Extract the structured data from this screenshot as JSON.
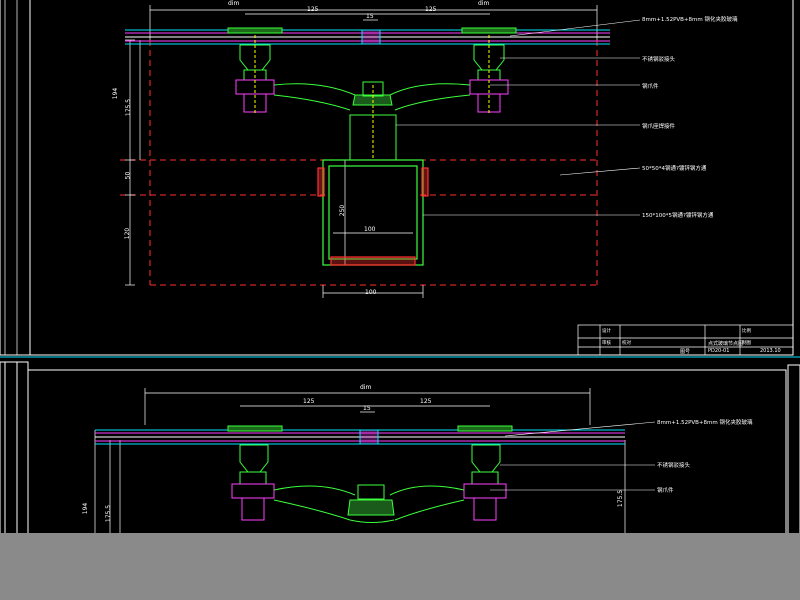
{
  "colors": {
    "background": "#000000",
    "frame": "#ffffff",
    "cyan": "#00e5ff",
    "green": "#3cff3c",
    "red": "#ff3030",
    "magenta": "#ff40ff",
    "yellow": "#ffff00",
    "gray_band": "#8a8a8a"
  },
  "top_view": {
    "dims": {
      "overall": "dim",
      "left_half": "125",
      "right_half": "125",
      "center_gap": "15",
      "overall_right": "dim",
      "left_vertical_a": "194",
      "left_vertical_b": "175.5",
      "left_vertical_c": "50",
      "left_vertical_d": "120",
      "inner_vertical": "250",
      "tube_inner_width": "100",
      "tube_bottom_width": "100"
    },
    "callouts": {
      "glass": "8mm+1.52PVB+8mm  钢化夹胶玻璃",
      "connector": "不锈钢驳接头",
      "claw": "钢爪件",
      "bolt_seat": "钢爪座焊接件",
      "square_tube_small": "50*50*4钢通?镀锌钢方通",
      "square_tube_large": "150*100*5钢通?镀锌钢方通"
    },
    "title_block": {
      "drawing_name": "点式玻璃节点图",
      "drawing_no": "PD20-01",
      "code_label": "图号",
      "date": "2013.10",
      "row_labels": [
        "设计",
        "审核",
        "校对",
        "制图",
        "比例"
      ]
    }
  },
  "bottom_view": {
    "dims": {
      "overall": "dim",
      "left_half": "125",
      "right_half": "125",
      "center_gap": "15",
      "left_vertical_a": "194",
      "left_vertical_b": "175.5",
      "right_vertical": "175.5"
    },
    "callouts": {
      "glass": "8mm+1.52PVB+8mm  钢化夹胶玻璃",
      "connector": "不锈钢驳接头",
      "claw": "钢爪件"
    }
  }
}
